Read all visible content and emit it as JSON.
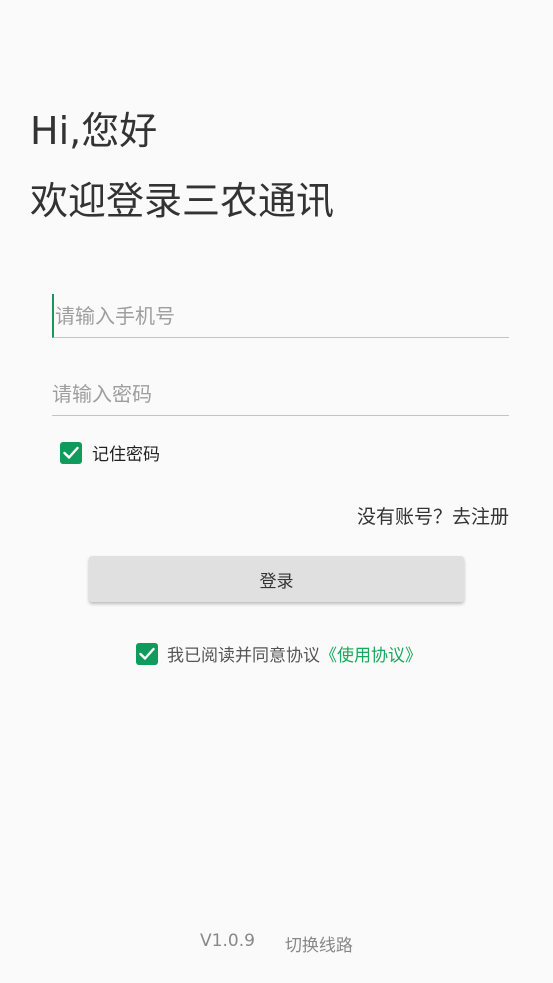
{
  "greeting": {
    "line1": "Hi,您好",
    "line2": "欢迎登录三农通讯"
  },
  "form": {
    "phone_placeholder": "请输入手机号",
    "password_placeholder": "请输入密码",
    "remember_label": "记住密码",
    "remember_checked": true,
    "register_text": "没有账号？去注册",
    "login_label": "登录"
  },
  "agreement": {
    "checked": true,
    "text": "我已阅读并同意协议",
    "link_text": "《使用协议》"
  },
  "footer": {
    "version": "V1.0.9",
    "switch_label": "切换线路"
  },
  "colors": {
    "accent": "#0f9b5b",
    "link": "#19a85b",
    "background": "#fafafa"
  }
}
